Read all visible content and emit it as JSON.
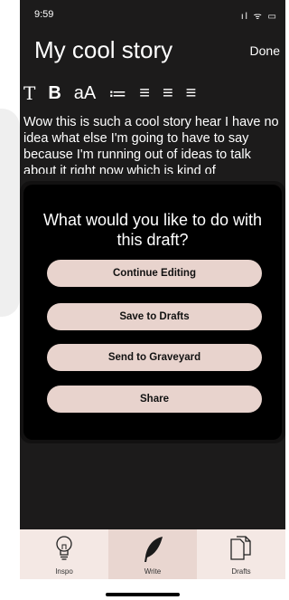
{
  "status": {
    "time": "9:59",
    "icons": "ıl ᯤ ▭"
  },
  "header": {
    "title": "My cool story",
    "done_label": "Done"
  },
  "toolbar": {
    "items": [
      "T",
      "B",
      "aA",
      "≔",
      "≡",
      "≡",
      "≡"
    ]
  },
  "story": {
    "text": "Wow this is such a cool story hear I have no idea what else I'm going to have to say because I'm running out of ideas to talk about it right now which is kind of"
  },
  "modal": {
    "title": "What would you like to do with this draft?",
    "buttons": [
      "Continue Editing",
      "Save to Drafts",
      "Send to Graveyard",
      "Share"
    ]
  },
  "tabbar": {
    "tabs": [
      {
        "label": "Inspo",
        "icon": "lightbulb-icon"
      },
      {
        "label": "Write",
        "icon": "feather-icon"
      },
      {
        "label": "Drafts",
        "icon": "documents-icon"
      }
    ]
  },
  "colors": {
    "background": "#1c1b1b",
    "button": "#e8d3cd",
    "tabbar": "#f4e8e4"
  }
}
